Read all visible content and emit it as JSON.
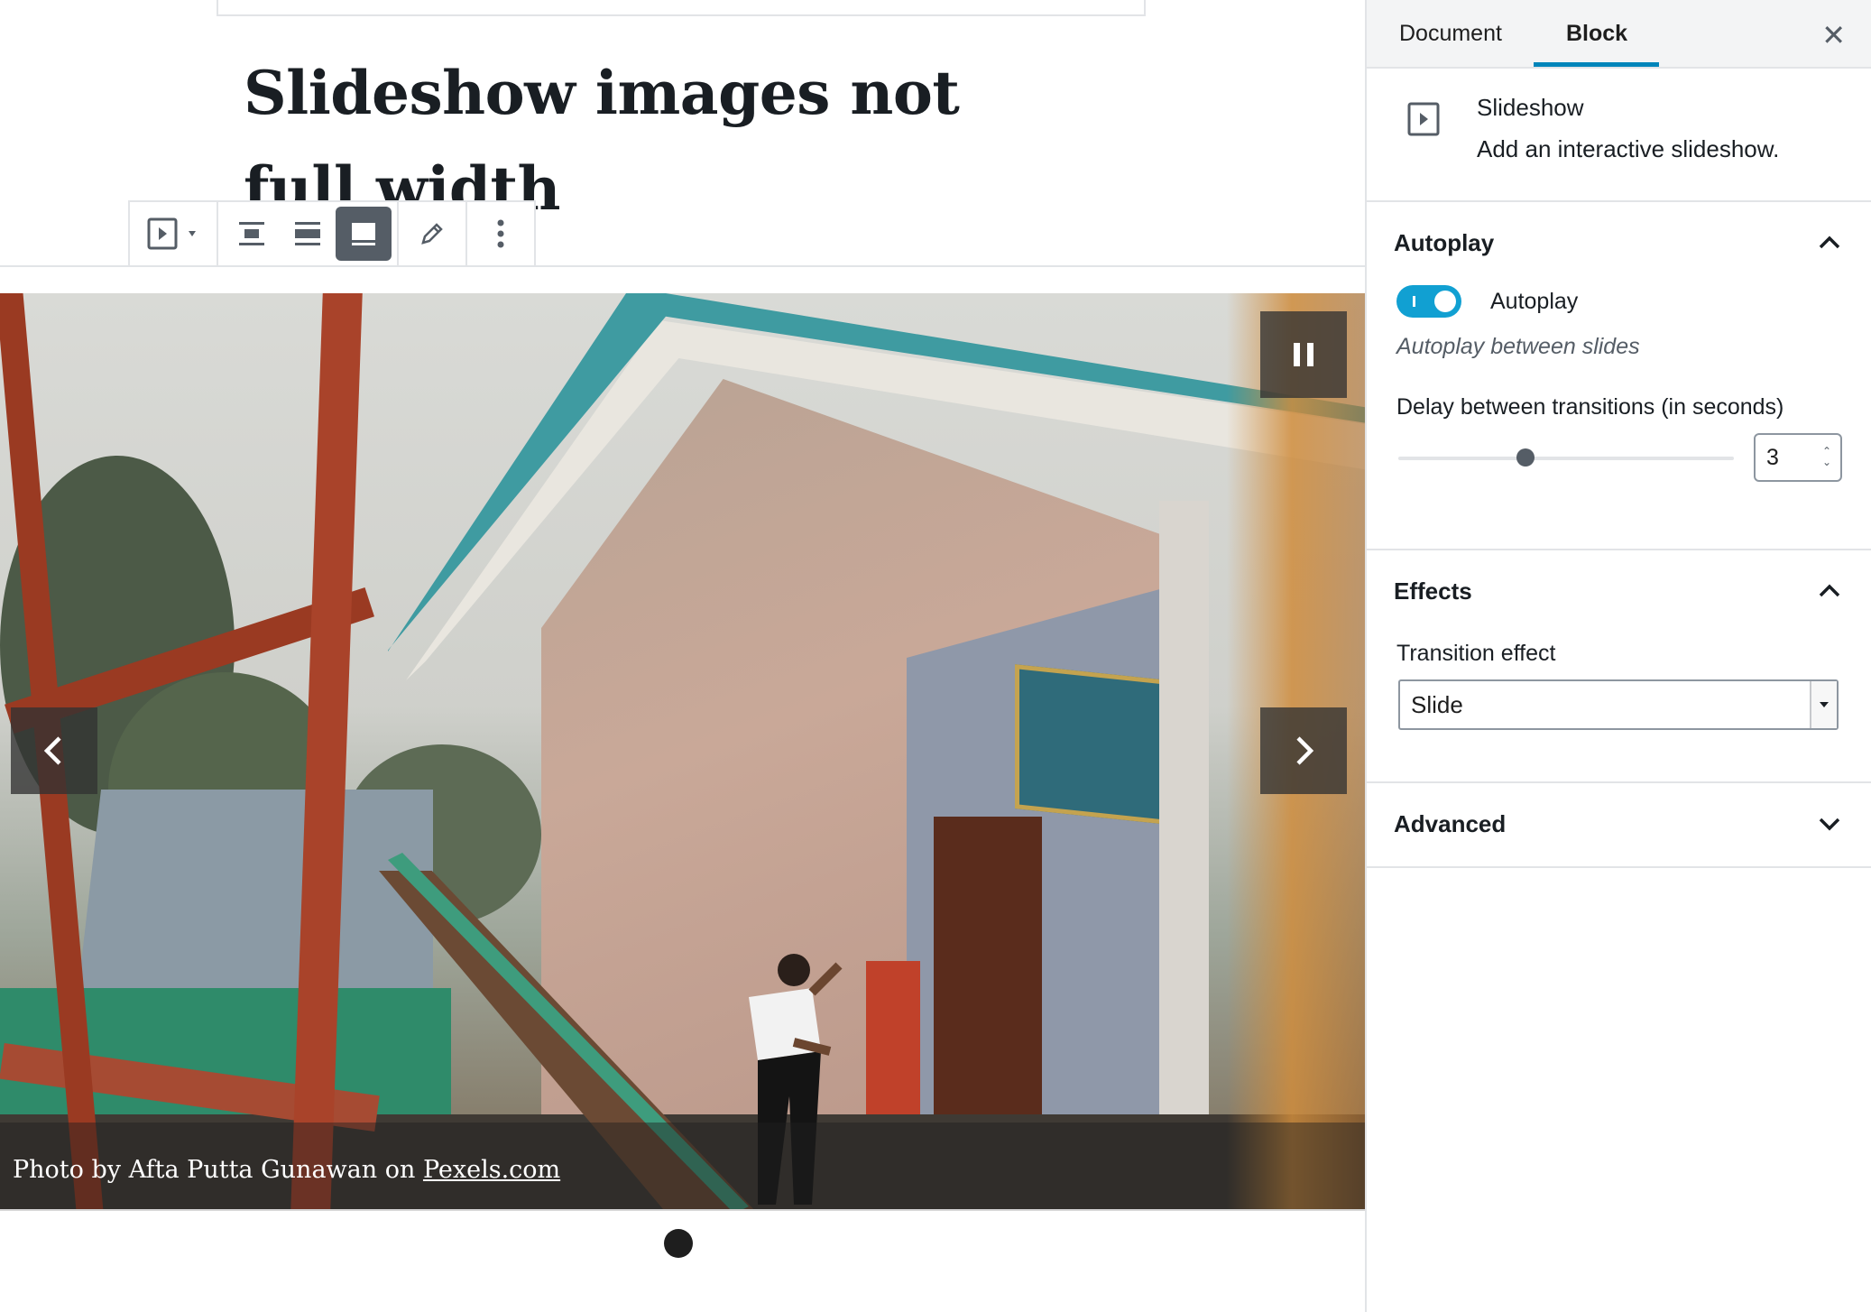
{
  "post": {
    "title": "Slideshow images not full width"
  },
  "toolbar": {
    "items": [
      "block-switcher",
      "align-center",
      "align-wide",
      "align-full",
      "edit",
      "more-options"
    ],
    "active": "align-full"
  },
  "slideshow": {
    "caption_prefix": "Photo by Afta Putta Gunawan on ",
    "caption_link": "Pexels.com",
    "pause_icon": "pause-icon",
    "prev_icon": "chevron-left-icon",
    "next_icon": "chevron-right-icon",
    "slide_count": 1,
    "current_slide": 1
  },
  "sidebar": {
    "tabs": [
      {
        "label": "Document"
      },
      {
        "label": "Block"
      }
    ],
    "active_tab": "Block",
    "close_label": "✕",
    "block": {
      "name": "Slideshow",
      "description": "Add an interactive slideshow."
    },
    "autoplay_panel": {
      "title": "Autoplay",
      "toggle_label": "Autoplay",
      "toggle_on": true,
      "help": "Autoplay between slides",
      "delay_label": "Delay between transitions (in seconds)",
      "delay_value": "3",
      "delay_range_fraction": 0.38
    },
    "effects_panel": {
      "title": "Effects",
      "transition_label": "Transition effect",
      "transition_value": "Slide"
    },
    "advanced_panel": {
      "title": "Advanced"
    }
  },
  "colors": {
    "accent": "#0085ba",
    "toggle": "#11a0d2",
    "active_toolbar": "#555d66"
  }
}
